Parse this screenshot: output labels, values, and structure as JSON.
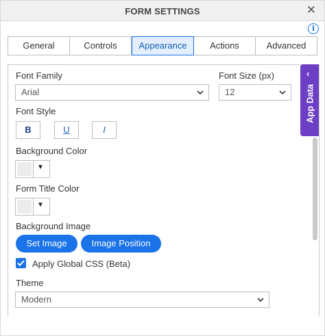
{
  "dialog": {
    "title": "FORM SETTINGS",
    "close_icon": "✕"
  },
  "tabs": [
    {
      "label": "General",
      "active": false
    },
    {
      "label": "Controls",
      "active": false
    },
    {
      "label": "Appearance",
      "active": true
    },
    {
      "label": "Actions",
      "active": false
    },
    {
      "label": "Advanced",
      "active": false
    }
  ],
  "font": {
    "family_label": "Font Family",
    "family_value": "Arial",
    "size_label": "Font Size (px)",
    "size_value": "12",
    "style_label": "Font Style",
    "bold": "B",
    "underline": "U",
    "italic": "I"
  },
  "background_color": {
    "label": "Background Color"
  },
  "form_title_color": {
    "label": "Form Title Color"
  },
  "background_image": {
    "label": "Background Image",
    "set_image": "Set Image",
    "image_position": "Image Position"
  },
  "global_css": {
    "label": "Apply Global CSS (Beta)",
    "checked": true
  },
  "theme": {
    "label": "Theme",
    "value": "Modern"
  },
  "app_data": {
    "label": "App Data"
  },
  "colors": {
    "accent": "#1a73e8",
    "app_data_bg": "#6c3fc5"
  }
}
